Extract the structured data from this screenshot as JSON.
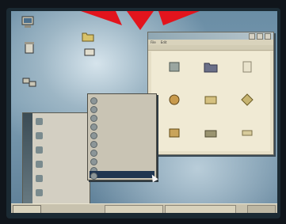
{
  "desktop": {
    "icons": [
      {
        "name": "my-computer-icon",
        "label": ""
      },
      {
        "name": "recycle-bin-icon",
        "label": ""
      },
      {
        "name": "network-icon",
        "label": ""
      },
      {
        "name": "folder-icon",
        "label": ""
      },
      {
        "name": "shortcut-icon",
        "label": ""
      }
    ]
  },
  "window": {
    "title": "",
    "menus": [
      "File",
      "Edit"
    ]
  },
  "start_menu": {
    "items": [
      "",
      "",
      "",
      "",
      "",
      "",
      ""
    ]
  },
  "programs_submenu": {
    "items": [
      "",
      "",
      "",
      "",
      "",
      "",
      "",
      "",
      "",
      ""
    ]
  },
  "taskbar": {
    "start_label": ""
  },
  "colors": {
    "desktop": "#7c9db2",
    "window_bg": "#e6dfc7",
    "menu_bg": "#d3cfc2",
    "selection": "#1f3550",
    "arrow": "#e3141d"
  }
}
